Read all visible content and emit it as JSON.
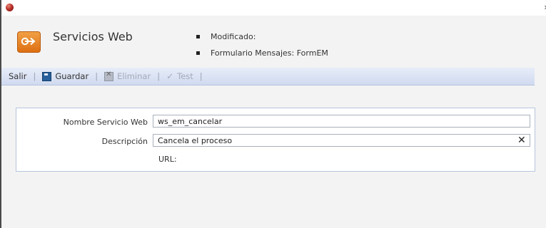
{
  "window": {
    "close_glyph": "›",
    "accent": "#b8322a"
  },
  "header": {
    "title": "Servicios Web",
    "icon": "enter-arrow-icon",
    "meta": [
      "Modificado:",
      "Formulario Mensajes: FormEM"
    ]
  },
  "toolbar": {
    "items": [
      {
        "label": "Salir",
        "enabled": true
      },
      {
        "label": "Guardar",
        "icon": "floppy-disk-icon",
        "enabled": true
      },
      {
        "label": "Eliminar",
        "icon": "delete-icon",
        "enabled": false
      },
      {
        "label": "Test",
        "icon": "checkmark-icon",
        "enabled": false
      }
    ],
    "separator": "|",
    "background": "#d9e1f4"
  },
  "form": {
    "nombre_label": "Nombre Servicio Web",
    "nombre_value": "ws_em_cancelar",
    "descripcion_label": "Descripción",
    "descripcion_value": "Cancela el proceso",
    "clear_glyph": "✕",
    "url_label": "URL:"
  }
}
